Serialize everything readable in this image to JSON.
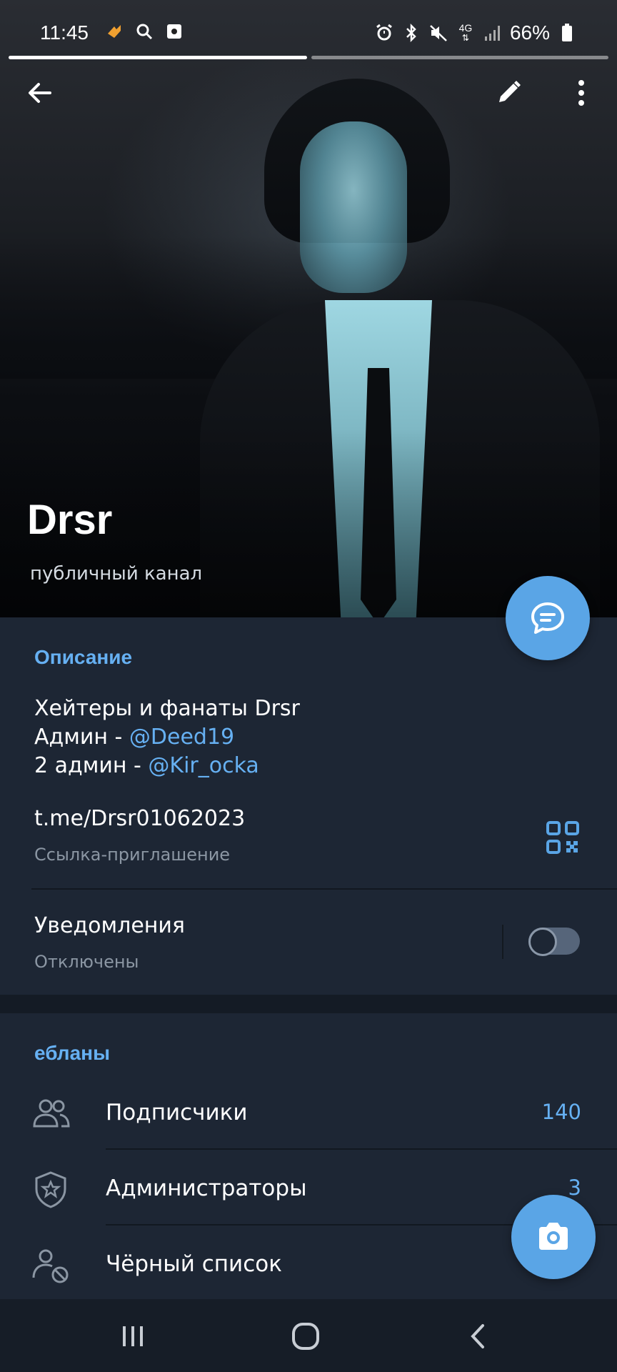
{
  "status_bar": {
    "time": "11:45",
    "battery": "66%",
    "network": "4G",
    "left_icons": [
      "flame-icon",
      "search-icon",
      "screenshot-icon"
    ],
    "right_icons": [
      "alarm-icon",
      "bluetooth-icon",
      "mute-icon",
      "network-icon",
      "signal-icon",
      "battery-icon"
    ]
  },
  "header": {
    "title": "Drsr",
    "subtitle": "публичный канал"
  },
  "description": {
    "heading": "Описание",
    "line1": "Хейтеры и фанаты Drsr",
    "line2_prefix": "Админ - ",
    "line2_mention": "@Deed19",
    "line3_prefix": "2 админ - ",
    "line3_mention": "@Kir_ocka"
  },
  "invite": {
    "link": "t.me/Drsr01062023",
    "label": "Ссылка-приглашение"
  },
  "notifications": {
    "title": "Уведомления",
    "status": "Отключены",
    "enabled": false
  },
  "members_section": {
    "heading": "ебланы",
    "rows": [
      {
        "label": "Подписчики",
        "count": "140",
        "icon": "subscribers-icon"
      },
      {
        "label": "Администраторы",
        "count": "3",
        "icon": "admin-shield-icon"
      },
      {
        "label": "Чёрный список",
        "count": "",
        "icon": "blacklist-icon"
      }
    ]
  },
  "colors": {
    "accent": "#5aa5e6",
    "link": "#66b0f2",
    "background": "#1d2634",
    "secondary_text": "#8b96a3"
  }
}
